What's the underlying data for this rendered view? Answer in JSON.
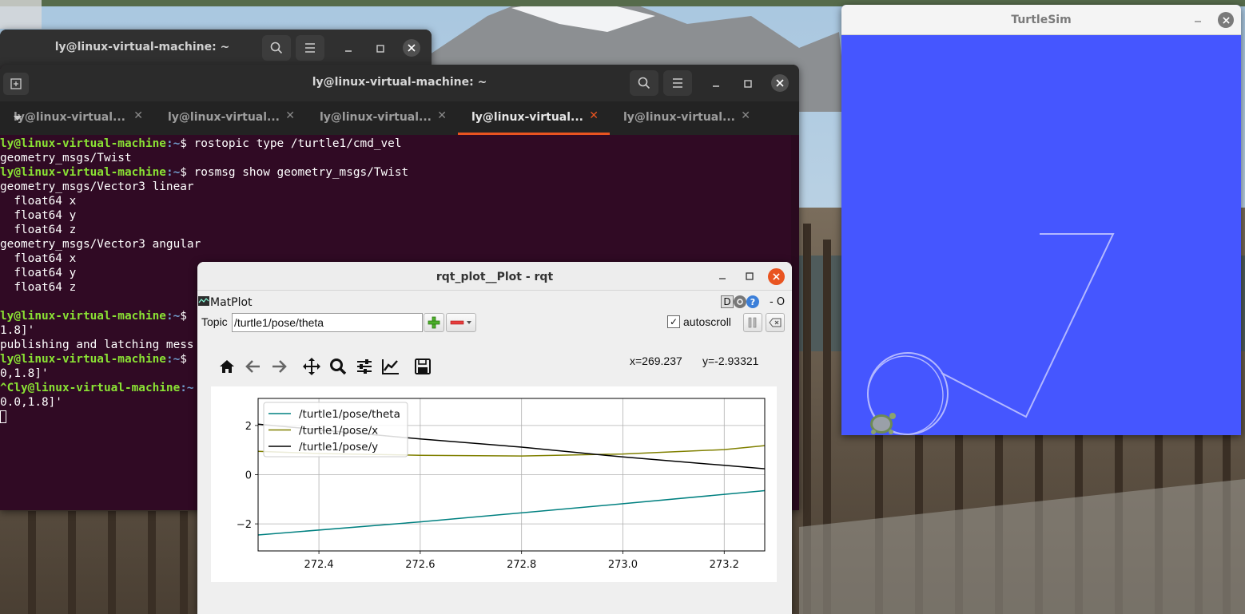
{
  "colors": {
    "terminal_bg": "#300a24",
    "prompt_green": "#8ae234",
    "path_blue": "#729fcf",
    "tab_accent": "#e95420",
    "turtlesim_bg": "#4556ff",
    "close_orange": "#e95420"
  },
  "terminal_back": {
    "title": "ly@linux-virtual-machine: ~"
  },
  "terminal_main": {
    "title": "ly@linux-virtual-machine: ~",
    "tabs": [
      {
        "label": "ly@linux-virtual..."
      },
      {
        "label": "ly@linux-virtual..."
      },
      {
        "label": "ly@linux-virtual..."
      },
      {
        "label": "ly@linux-virtual..."
      },
      {
        "label": "ly@linux-virtual..."
      }
    ],
    "lines": [
      {
        "prompt": "ly@linux-virtual-machine",
        "path": ":~",
        "text": "$ rostopic type /turtle1/cmd_vel"
      },
      {
        "prompt": "",
        "path": "",
        "text": "geometry_msgs/Twist"
      },
      {
        "prompt": "ly@linux-virtual-machine",
        "path": ":~",
        "text": "$ rosmsg show geometry_msgs/Twist"
      },
      {
        "prompt": "",
        "path": "",
        "text": "geometry_msgs/Vector3 linear"
      },
      {
        "prompt": "",
        "path": "",
        "text": "  float64 x"
      },
      {
        "prompt": "",
        "path": "",
        "text": "  float64 y"
      },
      {
        "prompt": "",
        "path": "",
        "text": "  float64 z"
      },
      {
        "prompt": "",
        "path": "",
        "text": "geometry_msgs/Vector3 angular"
      },
      {
        "prompt": "",
        "path": "",
        "text": "  float64 x"
      },
      {
        "prompt": "",
        "path": "",
        "text": "  float64 y"
      },
      {
        "prompt": "",
        "path": "",
        "text": "  float64 z"
      },
      {
        "prompt": "",
        "path": "",
        "text": ""
      },
      {
        "prompt": "ly@linux-virtual-machine",
        "path": ":~",
        "text": "$"
      },
      {
        "prompt": "",
        "path": "",
        "text": "1.8]'"
      },
      {
        "prompt": "",
        "path": "",
        "text": "publishing and latching mess"
      },
      {
        "prompt": "ly@linux-virtual-machine",
        "path": ":~",
        "text": "$"
      },
      {
        "prompt": "",
        "path": "",
        "text": "0,1.8]'"
      },
      {
        "prompt": "^Cly@linux-virtual-machine",
        "path": ":~",
        "text": ""
      },
      {
        "prompt": "",
        "path": "",
        "text": "0.0,1.8]'"
      }
    ]
  },
  "turtlesim": {
    "title": "TurtleSim"
  },
  "rqt": {
    "title": "rqt_plot__Plot - rqt",
    "plugin_name": "MatPlot",
    "plugin_controls": "- O",
    "help_d": "D",
    "topic_label": "Topic",
    "topic_value": "/turtle1/pose/theta",
    "autoscroll_label": "autoscroll",
    "autoscroll_checked": true,
    "coord_x": "x=269.237",
    "coord_y": "y=-2.93321",
    "toolbar_icons": [
      "home-icon",
      "back-arrow-icon",
      "forward-arrow-icon",
      "pan-icon",
      "zoom-icon",
      "configure-subplots-icon",
      "edit-axes-icon",
      "save-icon"
    ]
  },
  "chart_data": {
    "type": "line",
    "xlim": [
      272.28,
      273.28
    ],
    "ylim": [
      -3.1,
      3.1
    ],
    "xticks": [
      272.4,
      272.6,
      272.8,
      273.0,
      273.2
    ],
    "xtick_labels": [
      "272.4",
      "272.6",
      "272.8",
      "273.0",
      "273.2"
    ],
    "yticks": [
      2,
      0,
      -2
    ],
    "ytick_labels": [
      "2",
      "0",
      "−2"
    ],
    "grid": true,
    "legend_position": "top-left",
    "series": [
      {
        "name": "/turtle1/pose/theta",
        "color": "#008080",
        "x": [
          272.28,
          272.6,
          273.0,
          273.28
        ],
        "y": [
          -2.45,
          -1.92,
          -1.18,
          -0.65
        ]
      },
      {
        "name": "/turtle1/pose/x",
        "color": "#808000",
        "x": [
          272.28,
          272.4,
          272.6,
          272.8,
          273.0,
          273.2,
          273.28
        ],
        "y": [
          0.95,
          0.86,
          0.79,
          0.76,
          0.84,
          1.02,
          1.18
        ]
      },
      {
        "name": "/turtle1/pose/y",
        "color": "#000000",
        "x": [
          272.28,
          272.6,
          272.8,
          273.0,
          273.2,
          273.28
        ],
        "y": [
          2.05,
          1.45,
          1.12,
          0.72,
          0.38,
          0.24
        ]
      }
    ]
  }
}
